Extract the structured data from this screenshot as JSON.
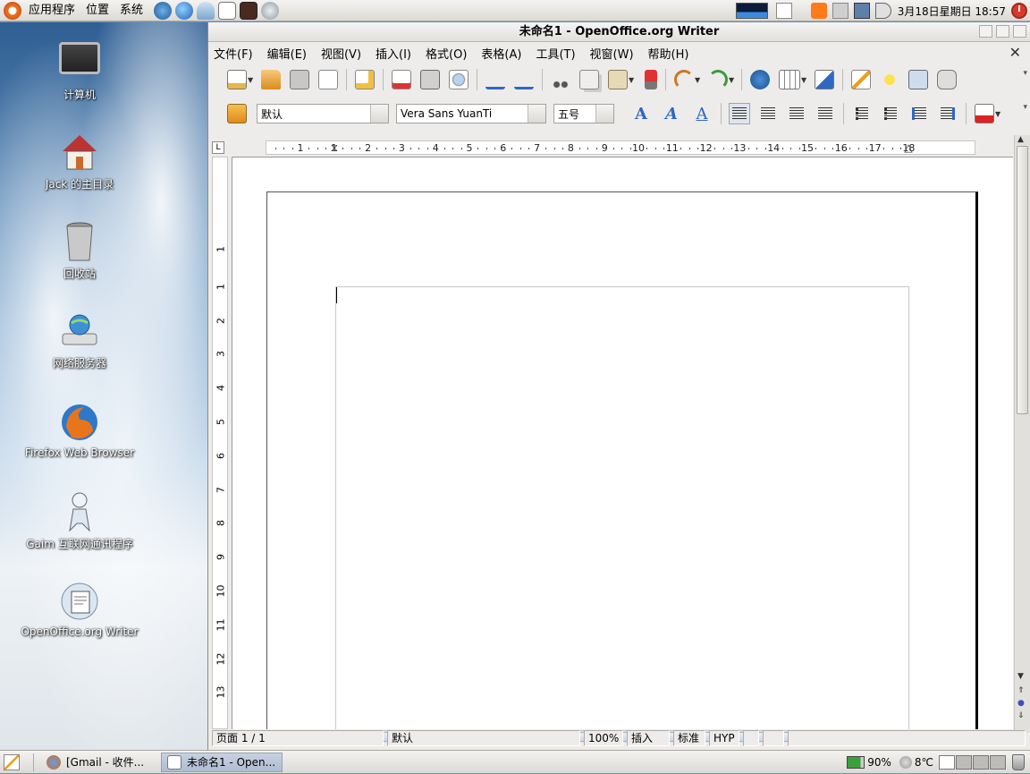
{
  "top_panel": {
    "menus": [
      "应用程序",
      "位置",
      "系统"
    ],
    "clock": "3月18日星期日 18:57"
  },
  "desktop": {
    "icons": [
      {
        "label": "计算机",
        "icon": "computer-icon"
      },
      {
        "label": "Jack 的主目录",
        "icon": "home-folder-icon"
      },
      {
        "label": "回收站",
        "icon": "trash-icon"
      },
      {
        "label": "网络服务器",
        "icon": "network-server-icon"
      },
      {
        "label": "Firefox Web Browser",
        "icon": "firefox-icon"
      },
      {
        "label": "Gaim 互联网通讯程序",
        "icon": "gaim-icon"
      },
      {
        "label": "OpenOffice.org Writer",
        "icon": "writer-icon"
      }
    ]
  },
  "window": {
    "title": "未命名1 - OpenOffice.org Writer",
    "menu": [
      "文件(F)",
      "编辑(E)",
      "视图(V)",
      "插入(I)",
      "格式(O)",
      "表格(A)",
      "工具(T)",
      "视窗(W)",
      "帮助(H)"
    ],
    "formatting": {
      "style": "默认",
      "font": "Vera Sans YuanTi",
      "size": "五号"
    },
    "ruler_h": [
      "1",
      "1",
      "2",
      "3",
      "4",
      "5",
      "6",
      "7",
      "8",
      "9",
      "10",
      "11",
      "12",
      "13",
      "14",
      "15",
      "16",
      "17",
      "18"
    ],
    "ruler_v": [
      "1",
      "1",
      "2",
      "3",
      "4",
      "5",
      "6",
      "7",
      "8",
      "9",
      "10",
      "11",
      "12",
      "13"
    ],
    "status": {
      "page": "页面 1 / 1",
      "style": "默认",
      "zoom": "100%",
      "insert": "插入",
      "select": "标准",
      "hyp": "HYP"
    }
  },
  "bottom_panel": {
    "tasks": [
      {
        "label": "[Gmail - 收件...",
        "active": false
      },
      {
        "label": "未命名1 - Open...",
        "active": true
      }
    ],
    "battery": "90%",
    "temperature": "8℃"
  },
  "colors": {
    "accent": "#2f68c0",
    "panel": "#e6e4e0",
    "power": "#d93a2a"
  }
}
